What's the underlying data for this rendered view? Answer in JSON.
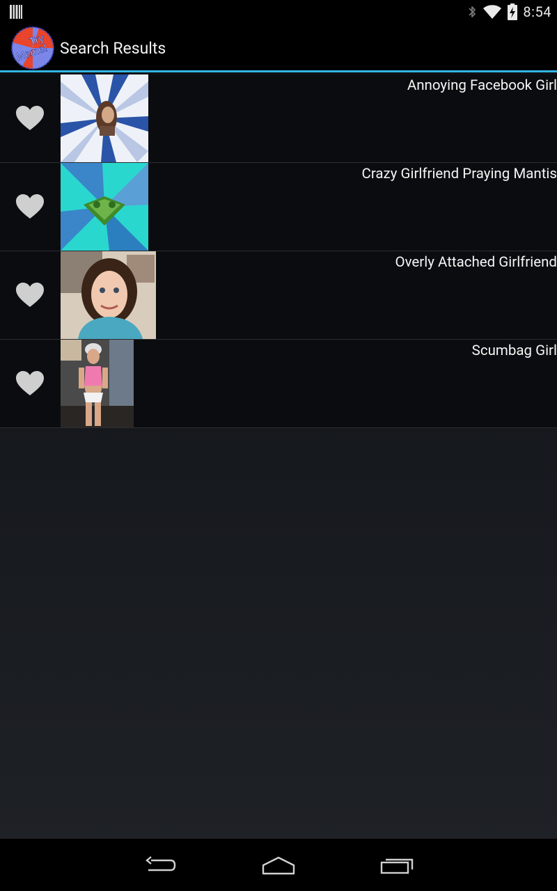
{
  "status_bar": {
    "time": "8:54",
    "icons": [
      "barcode-icon",
      "bluetooth-icon",
      "wifi-icon",
      "battery-charging-icon"
    ]
  },
  "action_bar": {
    "title": "Search Results",
    "logo_text_line1": "Try",
    "logo_text_line2": "Meme!"
  },
  "results": [
    {
      "title": "Annoying Facebook Girl",
      "thumbnail": "annoying-facebook-girl-thumbnail",
      "favorite_icon": "heart-icon"
    },
    {
      "title": "Crazy Girlfriend Praying Mantis",
      "thumbnail": "praying-mantis-thumbnail",
      "favorite_icon": "heart-icon"
    },
    {
      "title": "Overly Attached Girlfriend",
      "thumbnail": "overly-attached-girlfriend-thumbnail",
      "favorite_icon": "heart-icon"
    },
    {
      "title": "Scumbag Girl",
      "thumbnail": "scumbag-girl-thumbnail",
      "favorite_icon": "heart-icon"
    }
  ],
  "nav_bar": {
    "buttons": [
      "back-icon",
      "home-icon",
      "recent-apps-icon"
    ]
  },
  "colors": {
    "accent": "#33b5e5",
    "heart": "#cfcfcf",
    "row_background": "#0b0c0f"
  }
}
